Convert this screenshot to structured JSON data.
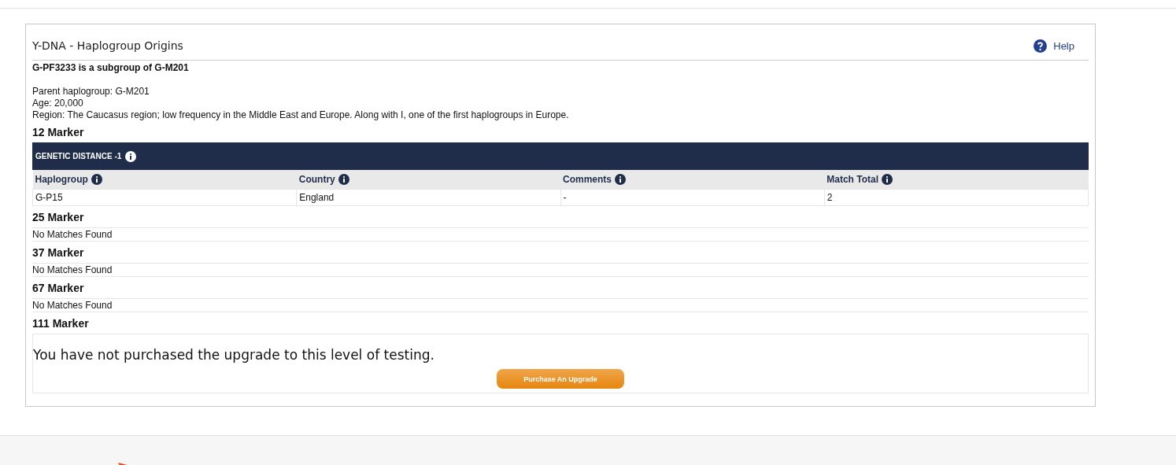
{
  "panel": {
    "title": "Y-DNA - Haplogroup Origins",
    "help": "Help"
  },
  "summary": {
    "heading": "G-PF3233 is a subgroup of G-M201",
    "lines": [
      "Parent haplogroup: G-M201",
      "Age: 20,000",
      "Region: The Caucasus region; low frequency in the Middle East and Europe. Along with I, one of the first haplogroups in Europe."
    ]
  },
  "markers": [
    {
      "title": "12 Marker",
      "kind": "table",
      "band": "GENETIC DISTANCE -1",
      "columns": [
        "Haplogroup",
        "Country",
        "Comments",
        "Match Total"
      ],
      "rows": [
        [
          "G-P15",
          "England",
          "-",
          "2"
        ]
      ]
    },
    {
      "title": "25 Marker",
      "kind": "empty",
      "message": "No Matches Found"
    },
    {
      "title": "37 Marker",
      "kind": "empty",
      "message": "No Matches Found"
    },
    {
      "title": "67 Marker",
      "kind": "empty",
      "message": "No Matches Found"
    },
    {
      "title": "111 Marker",
      "kind": "upgrade",
      "message": "You have not purchased the upgrade to this level of testing.",
      "button": "Purchase An Upgrade"
    }
  ]
}
